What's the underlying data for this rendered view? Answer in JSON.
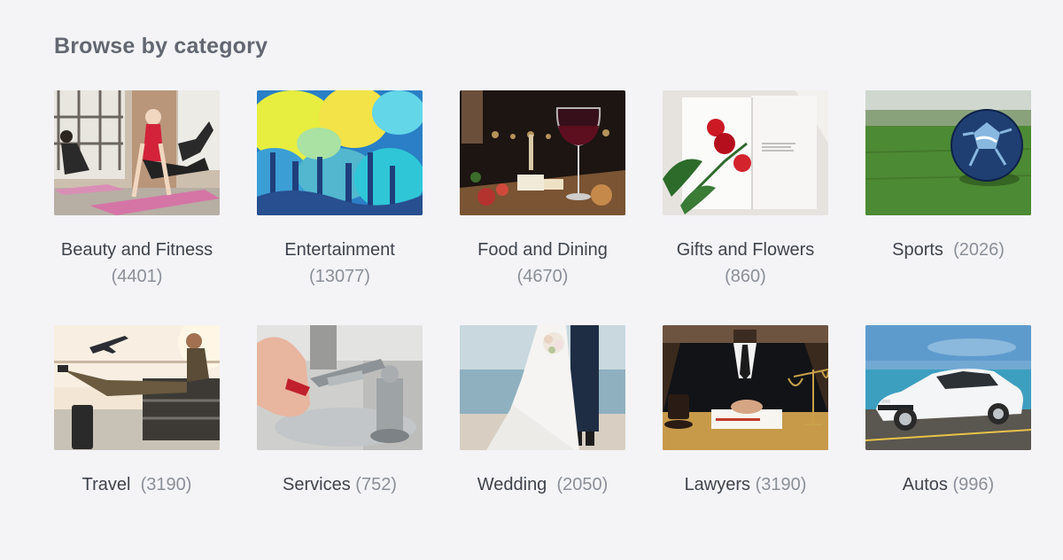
{
  "section": {
    "title": "Browse by category"
  },
  "categories": [
    {
      "name": "Beauty and Fitness",
      "count": "(4401)",
      "stacked": true,
      "image_icon": "fitness-photo-icon"
    },
    {
      "name": "Entertainment",
      "count": "(13077)",
      "stacked": true,
      "image_icon": "concert-photo-icon"
    },
    {
      "name": "Food and Dining",
      "count": "(4670)",
      "stacked": true,
      "image_icon": "food-photo-icon"
    },
    {
      "name": "Gifts and Flowers",
      "count": "(860)",
      "stacked": true,
      "image_icon": "flowers-photo-icon"
    },
    {
      "name": "Sports",
      "count": "(2026)",
      "stacked": false,
      "image_icon": "soccer-ball-photo-icon"
    },
    {
      "name": "Travel",
      "count": "(3190)",
      "stacked": false,
      "image_icon": "airport-photo-icon"
    },
    {
      "name": "Services",
      "count": "(752)",
      "stacked": false,
      "image_icon": "plumbing-tools-photo-icon"
    },
    {
      "name": "Wedding",
      "count": "(2050)",
      "stacked": false,
      "image_icon": "wedding-photo-icon"
    },
    {
      "name": "Lawyers",
      "count": "(3190)",
      "stacked": false,
      "image_icon": "lawyer-photo-icon"
    },
    {
      "name": "Autos",
      "count": "(996)",
      "stacked": false,
      "image_icon": "car-photo-icon"
    }
  ],
  "colors": {
    "background": "#f4f4f7",
    "title": "#626771",
    "label": "#3f434b",
    "count": "#8b8f97"
  }
}
